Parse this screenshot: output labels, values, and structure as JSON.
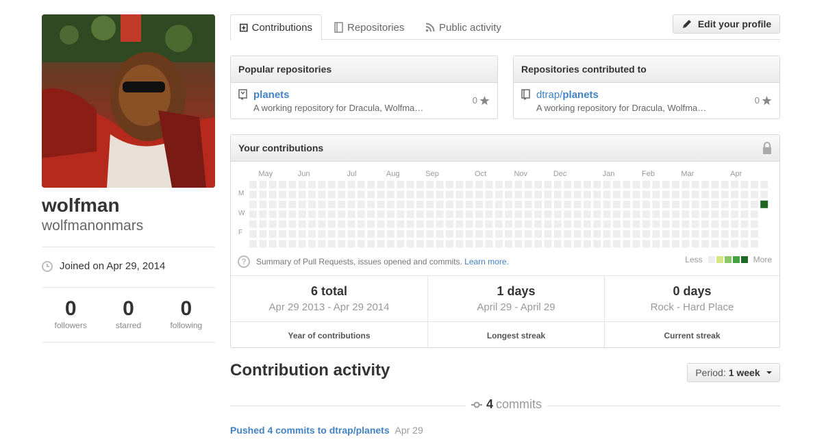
{
  "profile": {
    "fullname": "wolfman",
    "username": "wolfmanonmars",
    "joined": "Joined on Apr 29, 2014",
    "stats": [
      {
        "value": "0",
        "label": "followers"
      },
      {
        "value": "0",
        "label": "starred"
      },
      {
        "value": "0",
        "label": "following"
      }
    ]
  },
  "tabs": [
    {
      "label": "Contributions",
      "icon": "plus-box-icon",
      "selected": true
    },
    {
      "label": "Repositories",
      "icon": "book-icon",
      "selected": false
    },
    {
      "label": "Public activity",
      "icon": "rss-icon",
      "selected": false
    }
  ],
  "edit_profile": "Edit your profile",
  "popular": {
    "title": "Popular repositories",
    "repo_name": "planets",
    "repo_desc": "A working repository for Dracula, Wolfma…",
    "stars": "0"
  },
  "contributed": {
    "title": "Repositories contributed to",
    "owner": "dtrap/",
    "repo_name": "planets",
    "repo_desc": "A working repository for Dracula, Wolfma…",
    "stars": "0"
  },
  "contributions": {
    "title": "Your contributions",
    "months": [
      "May",
      "Jun",
      "Jul",
      "Aug",
      "Sep",
      "Oct",
      "Nov",
      "Dec",
      "Jan",
      "Feb",
      "Mar",
      "Apr"
    ],
    "days": [
      "M",
      "W",
      "F"
    ],
    "summary": "Summary of Pull Requests, issues opened and commits.",
    "learn_more": "Learn more.",
    "legend_less": "Less",
    "legend_more": "More",
    "legend_colors": [
      "#eeeeee",
      "#d6e685",
      "#8cc665",
      "#44a340",
      "#1e6823"
    ],
    "active_cell": {
      "date": "Apr 29",
      "count": 6,
      "color": "#1e6823"
    }
  },
  "streaks": [
    {
      "big": "6 total",
      "range": "Apr 29 2013 - Apr 29 2014",
      "caption": "Year of contributions"
    },
    {
      "big": "1 days",
      "range": "April 29 - April 29",
      "caption": "Longest streak"
    },
    {
      "big": "0 days",
      "range": "Rock - Hard Place",
      "caption": "Current streak"
    }
  ],
  "activity": {
    "title": "Contribution activity",
    "period_label": "Period:",
    "period_value": "1 week",
    "commit_count": "4",
    "commit_word": "commits",
    "pushed_text": "Pushed 4 commits to dtrap/planets",
    "pushed_date": "Apr 29"
  }
}
